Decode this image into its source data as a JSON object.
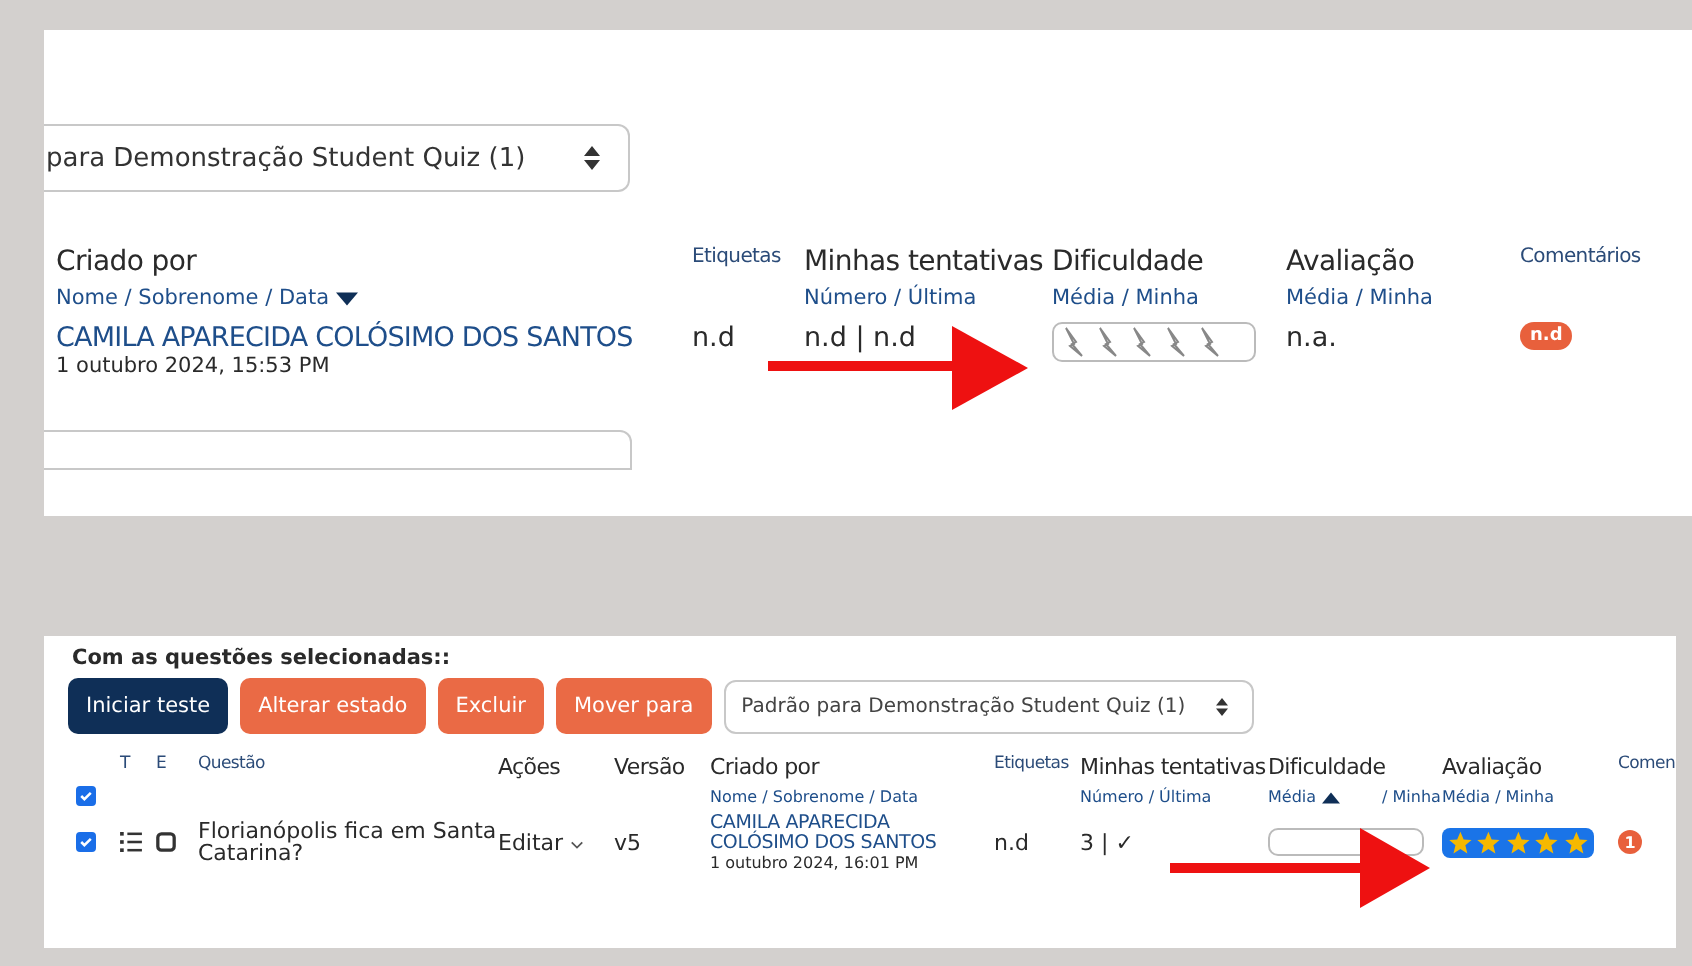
{
  "top_panel": {
    "select": {
      "value": "para Demonstração Student Quiz (1)"
    },
    "columns": [
      {
        "title": "Criado por",
        "subtitle": "Nome / Sobrenome / Data",
        "sort_desc": true,
        "kind": "creator"
      },
      {
        "title": "Etiquetas",
        "kind": "small"
      },
      {
        "title": "Minhas tentativas",
        "subtitle": "Número / Última",
        "kind": "normal"
      },
      {
        "title": "Dificuldade",
        "subtitle": "Média / Minha",
        "kind": "normal"
      },
      {
        "title": "Avaliação",
        "subtitle": "Média / Minha",
        "kind": "normal"
      },
      {
        "title": "Comentários",
        "kind": "small"
      }
    ],
    "row": {
      "creator_name": "CAMILA APARECIDA COLÓSIMO DOS SANTOS",
      "created": "1 outubro 2024, 15:53 PM",
      "tags": "n.d",
      "attempts": "n.d | n.d",
      "difficulty": {
        "level": 0
      },
      "rating": {
        "text": "n.a."
      },
      "comments": "n.d"
    }
  },
  "bottom_panel": {
    "heading": "Com as questões selecionadas::",
    "buttons": [
      {
        "label": "Iniciar teste",
        "kind": "primary"
      },
      {
        "label": "Alterar estado",
        "kind": "warning"
      },
      {
        "label": "Excluir",
        "kind": "warning"
      },
      {
        "label": "Mover para",
        "kind": "warning"
      }
    ],
    "select": {
      "value": "Padrão para Demonstração Student Quiz (1)"
    },
    "select_all": {
      "checked": true
    },
    "columns": [
      {
        "title": "T",
        "kind": "small"
      },
      {
        "title": "E",
        "kind": "small"
      },
      {
        "title": "Questão",
        "kind": "small"
      },
      {
        "title": "Ações",
        "kind": "normal"
      },
      {
        "title": "Versão",
        "kind": "normal"
      },
      {
        "title": "Criado por",
        "subtitle": "Nome / Sobrenome / Data",
        "kind": "creator"
      },
      {
        "title": "Etiquetas",
        "kind": "small"
      },
      {
        "title": "Minhas tentativas",
        "subtitle": "Número / Última",
        "kind": "normal"
      },
      {
        "title": "Dificuldade",
        "subtitle": "Média",
        "subtitle_2": "/ Minha",
        "sort_desc": false,
        "kind": "normal"
      },
      {
        "title": "Avaliação",
        "subtitle": "Média / Minha",
        "kind": "normal"
      },
      {
        "title": "Comen",
        "kind": "small"
      }
    ],
    "row": {
      "checked": true,
      "question": "Florianópolis fica em Santa Catarina?",
      "action": "Editar",
      "version": "v5",
      "creator_name": "CAMILA APARECIDA COLÓSIMO DOS SANTOS",
      "created": "1 outubro 2024, 16:01 PM",
      "tags": "n.d",
      "attempts": "3 | ✓",
      "difficulty": {
        "level": 0
      },
      "rating": {
        "stars": 5
      },
      "comments": "1"
    }
  }
}
